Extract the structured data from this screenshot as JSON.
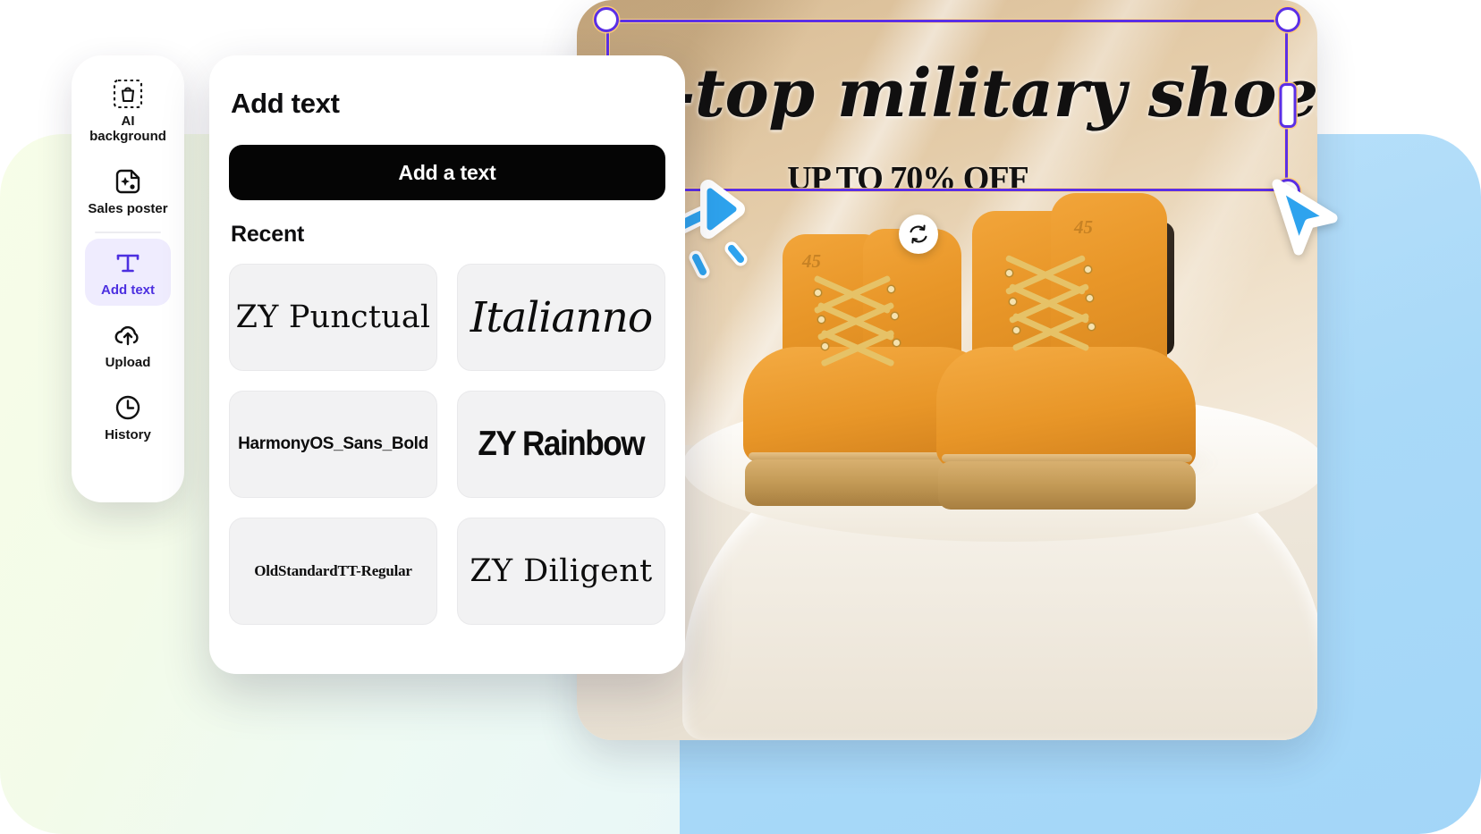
{
  "background": {
    "left_blob_color": "#f3fbe9",
    "right_blob_color": "#a9d9f8"
  },
  "tool_rail": {
    "items": [
      {
        "id": "ai-background",
        "label_line1": "AI",
        "label_line2": "background",
        "icon": "shopping-bag-in-frame-icon",
        "active": false
      },
      {
        "id": "sales-poster",
        "label_line1": "Sales poster",
        "label_line2": "",
        "icon": "image-sparkle-icon",
        "active": false
      },
      {
        "id": "add-text",
        "label_line1": "Add text",
        "label_line2": "",
        "icon": "text-t-icon",
        "active": true
      },
      {
        "id": "upload",
        "label_line1": "Upload",
        "label_line2": "",
        "icon": "cloud-upload-icon",
        "active": false
      },
      {
        "id": "history",
        "label_line1": "History",
        "label_line2": "",
        "icon": "clock-icon",
        "active": false
      }
    ],
    "active_color": "#4c2fe0",
    "active_bg": "#efecfe"
  },
  "panel": {
    "title": "Add text",
    "add_button_label": "Add a text",
    "recent_label": "Recent",
    "fonts": [
      {
        "name": "ZY Punctual",
        "style_class": "ft-punctual"
      },
      {
        "name": "Italianno",
        "style_class": "ft-italianno"
      },
      {
        "name": "HarmonyOS_Sans_Bold",
        "style_class": "ft-harmony"
      },
      {
        "name": "ZY Rainbow",
        "style_class": "ft-rainbow"
      },
      {
        "name": "OldStandardTT-Regular",
        "style_class": "ft-oldstd"
      },
      {
        "name": "ZY Diligent",
        "style_class": "ft-diligent"
      }
    ]
  },
  "canvas": {
    "headline": "High-top military shoes",
    "subline": "UP TO 70% OFF",
    "selection": {
      "color": "#5b2fe6",
      "handles": [
        "top-left-round",
        "top-right-round",
        "bottom-left-round",
        "bottom-right-round",
        "right-middle-bar"
      ],
      "rotate_icon": "rotate-refresh-icon"
    },
    "product": "wheat high-top boots on white pedestal"
  },
  "annotation": {
    "arrow": "curved-blue-arrow",
    "arrow_color": "#2ea3ee",
    "cursor": "blue-mouse-pointer"
  }
}
